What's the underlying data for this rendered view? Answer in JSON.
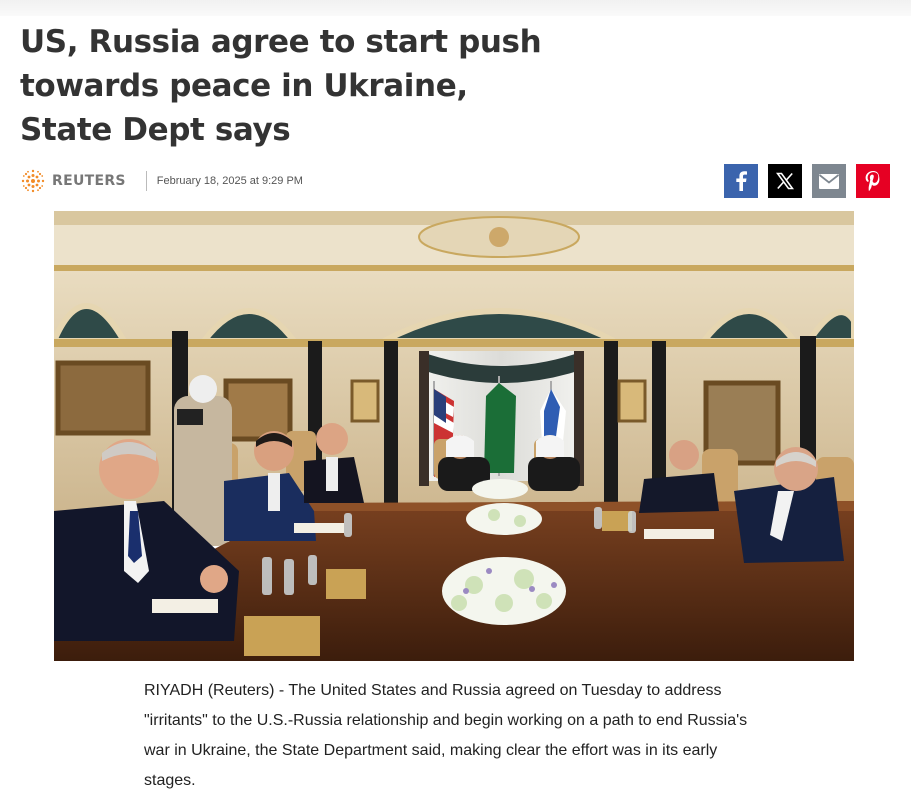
{
  "article": {
    "headline": "US, Russia agree to start push towards peace in Ukraine, State Dept says",
    "source": "REUTERS",
    "date": "February 18, 2025 at 9:29 PM",
    "body": "RIYADH (Reuters) - The United States and Russia agreed on Tuesday to address \"irritants\" to the U.S.-Russia relationship and begin working on a path to end Russia's war in Ukraine, the State Department said, making clear the effort was in its early stages."
  },
  "share_buttons": [
    {
      "icon": "facebook-icon",
      "color": "#3b64ad"
    },
    {
      "icon": "x-icon",
      "color": "#000000"
    },
    {
      "icon": "email-icon",
      "color": "#7e8790"
    },
    {
      "icon": "pinterest-icon",
      "color": "#e60023"
    }
  ],
  "photo": {
    "subject": "negotiation-table-scene"
  }
}
